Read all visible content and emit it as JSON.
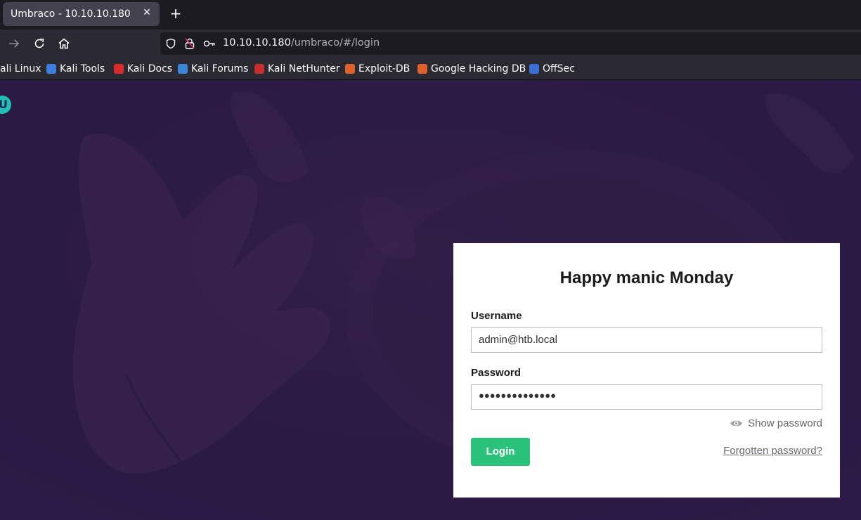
{
  "browser": {
    "tab_title": "Umbraco - 10.10.10.180",
    "tab_close_glyph": "✕",
    "new_tab_glyph": "+",
    "url_host": "10.10.10.180",
    "url_path": "/umbraco/#/login",
    "bookmarks": [
      {
        "label": "ali Linux",
        "icon": "kali-linux-icon",
        "color": "#2a72d8"
      },
      {
        "label": "Kali Tools",
        "icon": "kali-tools-icon",
        "color": "#3d7fe0"
      },
      {
        "label": "Kali Docs",
        "icon": "kali-docs-icon",
        "color": "#d92b2b"
      },
      {
        "label": "Kali Forums",
        "icon": "kali-forums-icon",
        "color": "#3b86d9"
      },
      {
        "label": "Kali NetHunter",
        "icon": "kali-nethunter-icon",
        "color": "#c92c2c"
      },
      {
        "label": "Exploit-DB",
        "icon": "exploit-db-icon",
        "color": "#e0602b"
      },
      {
        "label": "Google Hacking DB",
        "icon": "ghdb-icon",
        "color": "#e0602b"
      },
      {
        "label": "OffSec",
        "icon": "offsec-icon",
        "color": "#3a6fd8"
      }
    ]
  },
  "page": {
    "logo_letter": "U",
    "login": {
      "title": "Happy manic Monday",
      "username_label": "Username",
      "username_value": "admin@htb.local",
      "password_label": "Password",
      "password_masked": "●●●●●●●●●●●●●●",
      "show_password": "Show password",
      "login_button": "Login",
      "forgot_link": "Forgotten password?"
    }
  },
  "colors": {
    "accent_green": "#2bc37c",
    "logo_teal": "#20c0b8",
    "background_purple": "#2c1b46"
  }
}
